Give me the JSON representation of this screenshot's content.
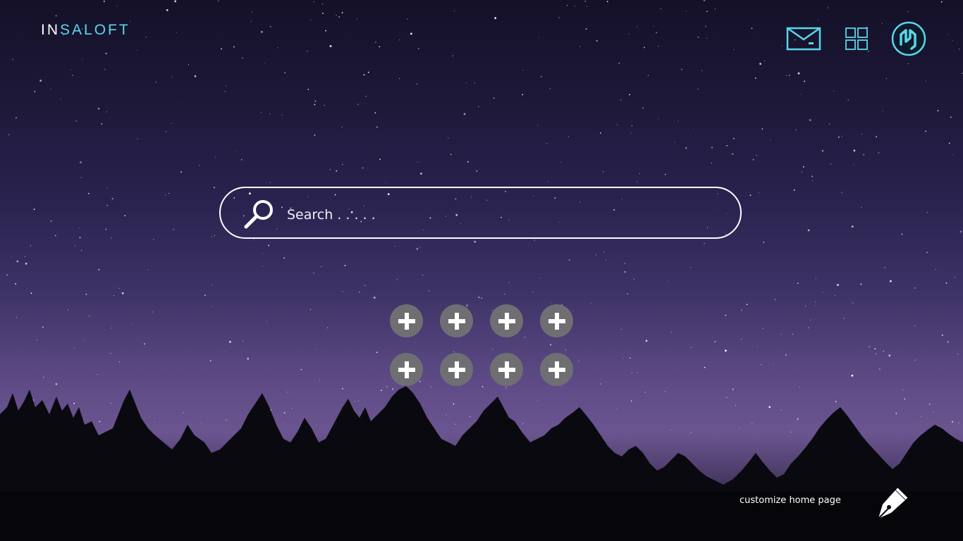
{
  "brand": {
    "part1": "IN",
    "part2": "SALOFT"
  },
  "header": {
    "icons": [
      "mail-icon",
      "apps-grid-icon",
      "profile-logo-icon"
    ]
  },
  "search": {
    "placeholder": "Search . . . . ."
  },
  "shortcuts": {
    "count": 8,
    "icon": "plus-icon"
  },
  "footer": {
    "customize_label": "customize home page",
    "icon": "fountain-pen-icon"
  },
  "colors": {
    "accent": "#5ad7ea",
    "shortcut_bg": "#6f6f73",
    "text": "#ffffff"
  }
}
